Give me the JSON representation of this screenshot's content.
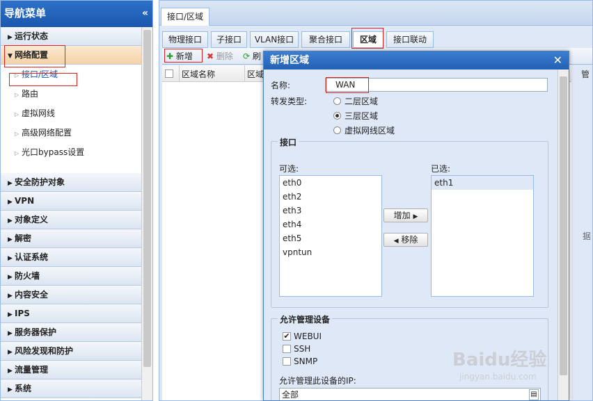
{
  "sidebar": {
    "title": "导航菜单",
    "collapse_glyph": "«",
    "groups_top": [
      {
        "label": "运行状态"
      },
      {
        "label": "网络配置"
      }
    ],
    "sub_items": [
      {
        "label": "接口/区域"
      },
      {
        "label": "路由"
      },
      {
        "label": "虚拟网线"
      },
      {
        "label": "高级网络配置"
      },
      {
        "label": "光口bypass设置"
      }
    ],
    "groups_bottom": [
      {
        "label": "安全防护对象"
      },
      {
        "label": "VPN"
      },
      {
        "label": "对象定义"
      },
      {
        "label": "解密"
      },
      {
        "label": "认证系统"
      },
      {
        "label": "防火墙"
      },
      {
        "label": "内容安全"
      },
      {
        "label": "IPS"
      },
      {
        "label": "服务器保护"
      },
      {
        "label": "风险发现和防护"
      },
      {
        "label": "流量管理"
      },
      {
        "label": "系统"
      }
    ]
  },
  "main": {
    "tab_title": "接口/区域",
    "subtabs": [
      "物理接口",
      "子接口",
      "VLAN接口",
      "聚合接口",
      "区域",
      "接口联动"
    ],
    "toolbar": {
      "add": "新增",
      "delete": "删除",
      "refresh": "刷"
    },
    "grid_headers": [
      "区域名称",
      "区域"
    ],
    "right_edge_text": "据",
    "right_edge_header": "管"
  },
  "dialog": {
    "title": "新增区域",
    "name_label": "名称:",
    "name_value": "WAN",
    "forward_label": "转发类型:",
    "forward_options": [
      "二层区域",
      "三层区域",
      "虚拟网线区域"
    ],
    "interface_group": "接口",
    "available_label": "可选:",
    "available": [
      "eth0",
      "eth2",
      "eth3",
      "eth4",
      "eth5",
      "vpntun"
    ],
    "add_btn": "增加",
    "remove_btn": "移除",
    "selected_label": "已选:",
    "selected": [
      "eth1"
    ],
    "manage_group": "允许管理设备",
    "manage_options": [
      "WEBUI",
      "SSH",
      "SNMP"
    ],
    "manage_ip_label": "允许管理此设备的IP:",
    "manage_ip_value": "全部"
  },
  "watermark": {
    "logo": "Baidu经验",
    "url": "jingyan.baidu.com"
  },
  "colors": {
    "header_blue": "#1b57ad",
    "highlight_red": "#e02020"
  }
}
